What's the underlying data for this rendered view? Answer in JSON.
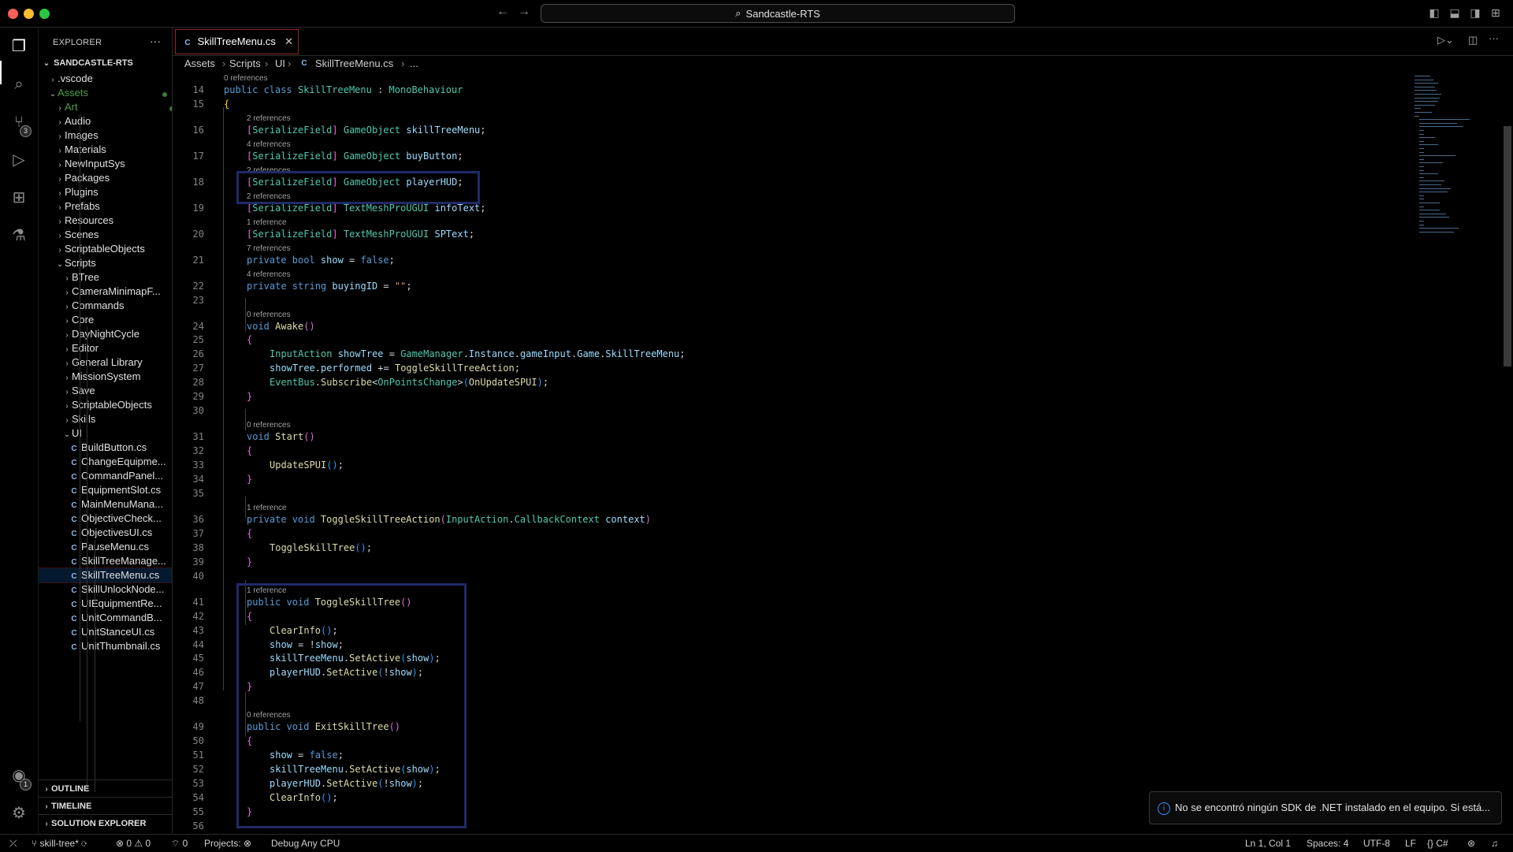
{
  "window": {
    "title": "Sandcastle-RTS"
  },
  "titlebar": {
    "back_icon": "arrow-left-icon",
    "forward_icon": "arrow-right-icon"
  },
  "explorer": {
    "header": "EXPLORER",
    "more": "···",
    "root": "SANDCASTLE-RTS",
    "items": [
      {
        "label": ".vscode",
        "kind": "folder",
        "open": false
      },
      {
        "label": "Assets",
        "kind": "folder",
        "open": true,
        "accent": "#4c9e4c"
      },
      {
        "label": "Art",
        "kind": "folder",
        "open": false,
        "accent": "#4c9e4c"
      },
      {
        "label": "Audio",
        "kind": "folder",
        "open": false
      },
      {
        "label": "Images",
        "kind": "folder",
        "open": false
      },
      {
        "label": "Materials",
        "kind": "folder",
        "open": false
      },
      {
        "label": "NewInputSys",
        "kind": "folder",
        "open": false
      },
      {
        "label": "Packages",
        "kind": "folder",
        "open": false
      },
      {
        "label": "Plugins",
        "kind": "folder",
        "open": false
      },
      {
        "label": "Prefabs",
        "kind": "folder",
        "open": false
      },
      {
        "label": "Resources",
        "kind": "folder",
        "open": false
      },
      {
        "label": "Scenes",
        "kind": "folder",
        "open": false
      },
      {
        "label": "ScriptableObjects",
        "kind": "folder",
        "open": false
      },
      {
        "label": "Scripts",
        "kind": "folder",
        "open": true
      },
      {
        "label": "BTree",
        "kind": "folder",
        "open": false
      },
      {
        "label": "CameraMinimapF...",
        "kind": "folder",
        "open": false
      },
      {
        "label": "Commands",
        "kind": "folder",
        "open": false
      },
      {
        "label": "Core",
        "kind": "folder",
        "open": false
      },
      {
        "label": "DayNightCycle",
        "kind": "folder",
        "open": false
      },
      {
        "label": "Editor",
        "kind": "folder",
        "open": false
      },
      {
        "label": "General Library",
        "kind": "folder",
        "open": false
      },
      {
        "label": "MissionSystem",
        "kind": "folder",
        "open": false
      },
      {
        "label": "Save",
        "kind": "folder",
        "open": false
      },
      {
        "label": "ScriptableObjects",
        "kind": "folder",
        "open": false
      },
      {
        "label": "Skills",
        "kind": "folder",
        "open": false
      },
      {
        "label": "UI",
        "kind": "folder",
        "open": true
      },
      {
        "label": "BuildButton.cs",
        "kind": "file"
      },
      {
        "label": "ChangeEquipme...",
        "kind": "file"
      },
      {
        "label": "CommandPanel...",
        "kind": "file"
      },
      {
        "label": "EquipmentSlot.cs",
        "kind": "file"
      },
      {
        "label": "MainMenuMana...",
        "kind": "file"
      },
      {
        "label": "ObjectiveCheck...",
        "kind": "file"
      },
      {
        "label": "ObjectivesUI.cs",
        "kind": "file"
      },
      {
        "label": "PauseMenu.cs",
        "kind": "file"
      },
      {
        "label": "SkillTreeManage...",
        "kind": "file"
      },
      {
        "label": "SkillTreeMenu.cs",
        "kind": "file",
        "selected": true
      },
      {
        "label": "SkillUnlockNode...",
        "kind": "file"
      },
      {
        "label": "UIEquipmentRe...",
        "kind": "file"
      },
      {
        "label": "UnitCommandB...",
        "kind": "file"
      },
      {
        "label": "UnitStanceUI.cs",
        "kind": "file"
      },
      {
        "label": "UnitThumbnail.cs",
        "kind": "file"
      }
    ],
    "panels": [
      "OUTLINE",
      "TIMELINE",
      "SOLUTION EXPLORER"
    ]
  },
  "editor": {
    "tab_label": "SkillTreeMenu.cs",
    "breadcrumb": [
      "Assets",
      "Scripts",
      "UI",
      "SkillTreeMenu.cs",
      "..."
    ],
    "lines": [
      {
        "n": "14",
        "lens": "0 references",
        "indent": 0,
        "tokens": [
          [
            "kw",
            "public "
          ],
          [
            "kw",
            "class "
          ],
          [
            "ty",
            "SkillTreeMenu"
          ],
          [
            "pl",
            " : "
          ],
          [
            "ty",
            "MonoBehaviour"
          ]
        ]
      },
      {
        "n": "15",
        "indent": 0,
        "tokens": [
          [
            "br1",
            "{"
          ]
        ]
      },
      {
        "n": "16",
        "lens": "2 references",
        "indent": 1,
        "tokens": [
          [
            "br2",
            "["
          ],
          [
            "ty",
            "SerializeField"
          ],
          [
            "br2",
            "]"
          ],
          [
            "pl",
            " "
          ],
          [
            "ty",
            "GameObject"
          ],
          [
            "pl",
            " "
          ],
          [
            "id",
            "skillTreeMenu"
          ],
          [
            "pl",
            ";"
          ]
        ]
      },
      {
        "n": "17",
        "lens": "4 references",
        "indent": 1,
        "tokens": [
          [
            "br2",
            "["
          ],
          [
            "ty",
            "SerializeField"
          ],
          [
            "br2",
            "]"
          ],
          [
            "pl",
            " "
          ],
          [
            "ty",
            "GameObject"
          ],
          [
            "pl",
            " "
          ],
          [
            "id",
            "buyButton"
          ],
          [
            "pl",
            ";"
          ]
        ]
      },
      {
        "n": "18",
        "lens": "2 references",
        "indent": 1,
        "tokens": [
          [
            "br2",
            "["
          ],
          [
            "ty",
            "SerializeField"
          ],
          [
            "br2",
            "]"
          ],
          [
            "pl",
            " "
          ],
          [
            "ty",
            "GameObject"
          ],
          [
            "pl",
            " "
          ],
          [
            "id",
            "playerHUD"
          ],
          [
            "pl",
            ";"
          ]
        ]
      },
      {
        "n": "19",
        "lens": "2 references",
        "indent": 1,
        "tokens": [
          [
            "br2",
            "["
          ],
          [
            "ty",
            "SerializeField"
          ],
          [
            "br2",
            "]"
          ],
          [
            "pl",
            " "
          ],
          [
            "ty",
            "TextMeshProUGUI"
          ],
          [
            "pl",
            " "
          ],
          [
            "id",
            "infoText"
          ],
          [
            "pl",
            ";"
          ]
        ]
      },
      {
        "n": "20",
        "lens": "1 reference",
        "indent": 1,
        "tokens": [
          [
            "br2",
            "["
          ],
          [
            "ty",
            "SerializeField"
          ],
          [
            "br2",
            "]"
          ],
          [
            "pl",
            " "
          ],
          [
            "ty",
            "TextMeshProUGUI"
          ],
          [
            "pl",
            " "
          ],
          [
            "id",
            "SPText"
          ],
          [
            "pl",
            ";"
          ]
        ]
      },
      {
        "n": "21",
        "lens": "7 references",
        "indent": 1,
        "tokens": [
          [
            "kw",
            "private "
          ],
          [
            "kw",
            "bool "
          ],
          [
            "id",
            "show"
          ],
          [
            "pl",
            " = "
          ],
          [
            "kw",
            "false"
          ],
          [
            "pl",
            ";"
          ]
        ]
      },
      {
        "n": "22",
        "lens": "4 references",
        "indent": 1,
        "tokens": [
          [
            "kw",
            "private "
          ],
          [
            "kw",
            "string "
          ],
          [
            "id",
            "buyingID"
          ],
          [
            "pl",
            " = "
          ],
          [
            "st",
            "\"\""
          ],
          [
            "pl",
            ";"
          ]
        ]
      },
      {
        "n": "23",
        "indent": 0,
        "tokens": []
      },
      {
        "n": "24",
        "lens": "0 references",
        "indent": 1,
        "tokens": [
          [
            "kw",
            "void "
          ],
          [
            "fn",
            "Awake"
          ],
          [
            "br2",
            "()"
          ]
        ]
      },
      {
        "n": "25",
        "indent": 1,
        "tokens": [
          [
            "br2",
            "{"
          ]
        ]
      },
      {
        "n": "26",
        "indent": 2,
        "tokens": [
          [
            "ty",
            "InputAction"
          ],
          [
            "pl",
            " "
          ],
          [
            "id",
            "showTree"
          ],
          [
            "pl",
            " = "
          ],
          [
            "ty",
            "GameManager"
          ],
          [
            "pl",
            "."
          ],
          [
            "id",
            "Instance"
          ],
          [
            "pl",
            "."
          ],
          [
            "id",
            "gameInput"
          ],
          [
            "pl",
            "."
          ],
          [
            "id",
            "Game"
          ],
          [
            "pl",
            "."
          ],
          [
            "id",
            "SkillTreeMenu"
          ],
          [
            "pl",
            ";"
          ]
        ]
      },
      {
        "n": "27",
        "indent": 2,
        "tokens": [
          [
            "id",
            "showTree"
          ],
          [
            "pl",
            "."
          ],
          [
            "id",
            "performed"
          ],
          [
            "pl",
            " += "
          ],
          [
            "fn",
            "ToggleSkillTreeAction"
          ],
          [
            "pl",
            ";"
          ]
        ]
      },
      {
        "n": "28",
        "indent": 2,
        "tokens": [
          [
            "ty",
            "EventBus"
          ],
          [
            "pl",
            "."
          ],
          [
            "fn",
            "Subscribe"
          ],
          [
            "pl",
            "<"
          ],
          [
            "ty",
            "OnPointsChange"
          ],
          [
            "pl",
            ">"
          ],
          [
            "br3",
            "("
          ],
          [
            "fn",
            "OnUpdateSPUI"
          ],
          [
            "br3",
            ")"
          ],
          [
            "pl",
            ";"
          ]
        ]
      },
      {
        "n": "29",
        "indent": 1,
        "tokens": [
          [
            "br2",
            "}"
          ]
        ]
      },
      {
        "n": "30",
        "indent": 0,
        "tokens": []
      },
      {
        "n": "31",
        "lens": "0 references",
        "indent": 1,
        "tokens": [
          [
            "kw",
            "void "
          ],
          [
            "fn",
            "Start"
          ],
          [
            "br2",
            "()"
          ]
        ]
      },
      {
        "n": "32",
        "indent": 1,
        "tokens": [
          [
            "br2",
            "{"
          ]
        ]
      },
      {
        "n": "33",
        "indent": 2,
        "tokens": [
          [
            "fn",
            "UpdateSPUI"
          ],
          [
            "br3",
            "()"
          ],
          [
            "pl",
            ";"
          ]
        ]
      },
      {
        "n": "34",
        "indent": 1,
        "tokens": [
          [
            "br2",
            "}"
          ]
        ]
      },
      {
        "n": "35",
        "indent": 0,
        "tokens": []
      },
      {
        "n": "36",
        "lens": "1 reference",
        "indent": 1,
        "tokens": [
          [
            "kw",
            "private "
          ],
          [
            "kw",
            "void "
          ],
          [
            "fn",
            "ToggleSkillTreeAction"
          ],
          [
            "br2",
            "("
          ],
          [
            "ty",
            "InputAction"
          ],
          [
            "pl",
            "."
          ],
          [
            "ty",
            "CallbackContext"
          ],
          [
            "pl",
            " "
          ],
          [
            "id",
            "context"
          ],
          [
            "br2",
            ")"
          ]
        ]
      },
      {
        "n": "37",
        "indent": 1,
        "tokens": [
          [
            "br2",
            "{"
          ]
        ]
      },
      {
        "n": "38",
        "indent": 2,
        "tokens": [
          [
            "fn",
            "ToggleSkillTree"
          ],
          [
            "br3",
            "()"
          ],
          [
            "pl",
            ";"
          ]
        ]
      },
      {
        "n": "39",
        "indent": 1,
        "tokens": [
          [
            "br2",
            "}"
          ]
        ]
      },
      {
        "n": "40",
        "indent": 0,
        "tokens": []
      },
      {
        "n": "41",
        "lens": "1 reference",
        "indent": 1,
        "tokens": [
          [
            "kw",
            "public "
          ],
          [
            "kw",
            "void "
          ],
          [
            "fn",
            "ToggleSkillTree"
          ],
          [
            "br2",
            "()"
          ]
        ]
      },
      {
        "n": "42",
        "indent": 1,
        "tokens": [
          [
            "br2",
            "{"
          ]
        ]
      },
      {
        "n": "43",
        "indent": 2,
        "tokens": [
          [
            "fn",
            "ClearInfo"
          ],
          [
            "br3",
            "()"
          ],
          [
            "pl",
            ";"
          ]
        ]
      },
      {
        "n": "44",
        "indent": 2,
        "tokens": [
          [
            "id",
            "show"
          ],
          [
            "pl",
            " = !"
          ],
          [
            "id",
            "show"
          ],
          [
            "pl",
            ";"
          ]
        ]
      },
      {
        "n": "45",
        "indent": 2,
        "tokens": [
          [
            "id",
            "skillTreeMenu"
          ],
          [
            "pl",
            "."
          ],
          [
            "fn",
            "SetActive"
          ],
          [
            "br3",
            "("
          ],
          [
            "id",
            "show"
          ],
          [
            "br3",
            ")"
          ],
          [
            "pl",
            ";"
          ]
        ]
      },
      {
        "n": "46",
        "indent": 2,
        "tokens": [
          [
            "id",
            "playerHUD"
          ],
          [
            "pl",
            "."
          ],
          [
            "fn",
            "SetActive"
          ],
          [
            "br3",
            "("
          ],
          [
            "pl",
            "!"
          ],
          [
            "id",
            "show"
          ],
          [
            "br3",
            ")"
          ],
          [
            "pl",
            ";"
          ]
        ]
      },
      {
        "n": "47",
        "indent": 1,
        "tokens": [
          [
            "br2",
            "}"
          ]
        ]
      },
      {
        "n": "48",
        "indent": 0,
        "tokens": []
      },
      {
        "n": "49",
        "lens": "0 references",
        "indent": 1,
        "tokens": [
          [
            "kw",
            "public "
          ],
          [
            "kw",
            "void "
          ],
          [
            "fn",
            "ExitSkillTree"
          ],
          [
            "br2",
            "()"
          ]
        ]
      },
      {
        "n": "50",
        "indent": 1,
        "tokens": [
          [
            "br2",
            "{"
          ]
        ]
      },
      {
        "n": "51",
        "indent": 2,
        "tokens": [
          [
            "id",
            "show"
          ],
          [
            "pl",
            " = "
          ],
          [
            "kw",
            "false"
          ],
          [
            "pl",
            ";"
          ]
        ]
      },
      {
        "n": "52",
        "indent": 2,
        "tokens": [
          [
            "id",
            "skillTreeMenu"
          ],
          [
            "pl",
            "."
          ],
          [
            "fn",
            "SetActive"
          ],
          [
            "br3",
            "("
          ],
          [
            "id",
            "show"
          ],
          [
            "br3",
            ")"
          ],
          [
            "pl",
            ";"
          ]
        ]
      },
      {
        "n": "53",
        "indent": 2,
        "tokens": [
          [
            "id",
            "playerHUD"
          ],
          [
            "pl",
            "."
          ],
          [
            "fn",
            "SetActive"
          ],
          [
            "br3",
            "("
          ],
          [
            "pl",
            "!"
          ],
          [
            "id",
            "show"
          ],
          [
            "br3",
            ")"
          ],
          [
            "pl",
            ";"
          ]
        ]
      },
      {
        "n": "54",
        "indent": 2,
        "tokens": [
          [
            "fn",
            "ClearInfo"
          ],
          [
            "br3",
            "()"
          ],
          [
            "pl",
            ";"
          ]
        ]
      },
      {
        "n": "55",
        "indent": 1,
        "tokens": [
          [
            "br2",
            "}"
          ]
        ]
      },
      {
        "n": "56",
        "indent": 0,
        "tokens": []
      }
    ]
  },
  "notification": {
    "text": "No se encontró ningún SDK de .NET instalado en el equipo. Si está..."
  },
  "statusbar": {
    "branch": "skill-tree*",
    "errors": "0",
    "warnings": "0",
    "ports": "0",
    "projects": "Projects:",
    "config": "Debug Any CPU",
    "position": "Ln 1, Col 1",
    "spaces": "Spaces: 4",
    "encoding": "UTF-8",
    "eol": "LF",
    "language": "C#"
  }
}
